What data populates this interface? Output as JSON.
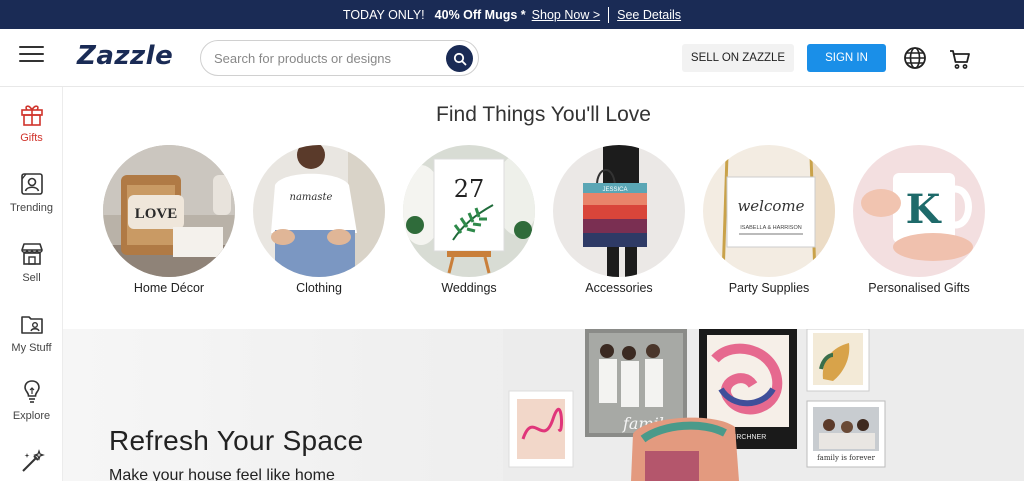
{
  "promo": {
    "text": "TODAY ONLY!",
    "offer": "40% Off Mugs *",
    "shop_link": "Shop Now >",
    "details_link": "See Details"
  },
  "header": {
    "logo": "Zazzle",
    "search_placeholder": "Search for products or designs",
    "sell_label": "SELL ON ZAZZLE",
    "signin_label": "SIGN IN"
  },
  "sidebar": {
    "items": [
      {
        "label": "Gifts",
        "icon": "gift-icon"
      },
      {
        "label": "Trending",
        "icon": "trending-icon"
      },
      {
        "label": "Sell",
        "icon": "store-icon"
      },
      {
        "label": "My Stuff",
        "icon": "folder-icon"
      },
      {
        "label": "Explore",
        "icon": "lightbulb-icon"
      },
      {
        "label": "",
        "icon": "design-wand-icon"
      }
    ]
  },
  "main": {
    "title": "Find Things You'll Love",
    "categories": [
      {
        "label": "Home Décor"
      },
      {
        "label": "Clothing"
      },
      {
        "label": "Weddings"
      },
      {
        "label": "Accessories"
      },
      {
        "label": "Party Supplies"
      },
      {
        "label": "Personalised Gifts"
      }
    ],
    "product_texts": {
      "love": "LOVE",
      "namaste": "namaste",
      "wedding_number": "27",
      "bag_name": "JESSICA",
      "welcome": "welcome",
      "welcome_names": "ISABELLA & HARRISON",
      "mug_letter": "K",
      "poster_name": "KIRCHNER",
      "family_caption": "family is forever",
      "family_script": "family"
    }
  },
  "hero": {
    "title": "Refresh Your Space",
    "subtitle": "Make your house feel like home"
  },
  "colors": {
    "brand_navy": "#1a2b55",
    "signin_blue": "#1a8fe8",
    "active_red": "#d0342c"
  }
}
